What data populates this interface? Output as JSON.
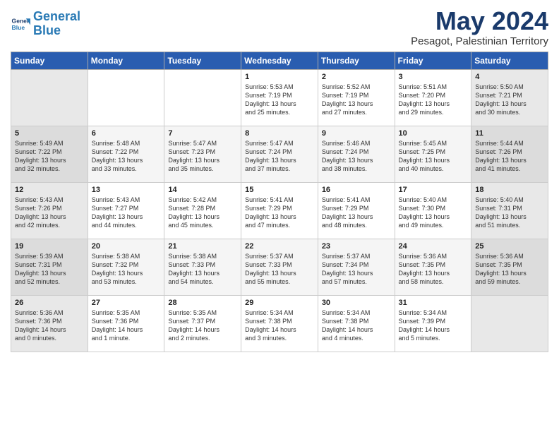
{
  "header": {
    "logo_line1": "General",
    "logo_line2": "Blue",
    "title": "May 2024",
    "subtitle": "Pesagot, Palestinian Territory"
  },
  "weekdays": [
    "Sunday",
    "Monday",
    "Tuesday",
    "Wednesday",
    "Thursday",
    "Friday",
    "Saturday"
  ],
  "weeks": [
    [
      {
        "day": "",
        "info": ""
      },
      {
        "day": "",
        "info": ""
      },
      {
        "day": "",
        "info": ""
      },
      {
        "day": "1",
        "info": "Sunrise: 5:53 AM\nSunset: 7:19 PM\nDaylight: 13 hours\nand 25 minutes."
      },
      {
        "day": "2",
        "info": "Sunrise: 5:52 AM\nSunset: 7:19 PM\nDaylight: 13 hours\nand 27 minutes."
      },
      {
        "day": "3",
        "info": "Sunrise: 5:51 AM\nSunset: 7:20 PM\nDaylight: 13 hours\nand 29 minutes."
      },
      {
        "day": "4",
        "info": "Sunrise: 5:50 AM\nSunset: 7:21 PM\nDaylight: 13 hours\nand 30 minutes."
      }
    ],
    [
      {
        "day": "5",
        "info": "Sunrise: 5:49 AM\nSunset: 7:22 PM\nDaylight: 13 hours\nand 32 minutes."
      },
      {
        "day": "6",
        "info": "Sunrise: 5:48 AM\nSunset: 7:22 PM\nDaylight: 13 hours\nand 33 minutes."
      },
      {
        "day": "7",
        "info": "Sunrise: 5:47 AM\nSunset: 7:23 PM\nDaylight: 13 hours\nand 35 minutes."
      },
      {
        "day": "8",
        "info": "Sunrise: 5:47 AM\nSunset: 7:24 PM\nDaylight: 13 hours\nand 37 minutes."
      },
      {
        "day": "9",
        "info": "Sunrise: 5:46 AM\nSunset: 7:24 PM\nDaylight: 13 hours\nand 38 minutes."
      },
      {
        "day": "10",
        "info": "Sunrise: 5:45 AM\nSunset: 7:25 PM\nDaylight: 13 hours\nand 40 minutes."
      },
      {
        "day": "11",
        "info": "Sunrise: 5:44 AM\nSunset: 7:26 PM\nDaylight: 13 hours\nand 41 minutes."
      }
    ],
    [
      {
        "day": "12",
        "info": "Sunrise: 5:43 AM\nSunset: 7:26 PM\nDaylight: 13 hours\nand 42 minutes."
      },
      {
        "day": "13",
        "info": "Sunrise: 5:43 AM\nSunset: 7:27 PM\nDaylight: 13 hours\nand 44 minutes."
      },
      {
        "day": "14",
        "info": "Sunrise: 5:42 AM\nSunset: 7:28 PM\nDaylight: 13 hours\nand 45 minutes."
      },
      {
        "day": "15",
        "info": "Sunrise: 5:41 AM\nSunset: 7:29 PM\nDaylight: 13 hours\nand 47 minutes."
      },
      {
        "day": "16",
        "info": "Sunrise: 5:41 AM\nSunset: 7:29 PM\nDaylight: 13 hours\nand 48 minutes."
      },
      {
        "day": "17",
        "info": "Sunrise: 5:40 AM\nSunset: 7:30 PM\nDaylight: 13 hours\nand 49 minutes."
      },
      {
        "day": "18",
        "info": "Sunrise: 5:40 AM\nSunset: 7:31 PM\nDaylight: 13 hours\nand 51 minutes."
      }
    ],
    [
      {
        "day": "19",
        "info": "Sunrise: 5:39 AM\nSunset: 7:31 PM\nDaylight: 13 hours\nand 52 minutes."
      },
      {
        "day": "20",
        "info": "Sunrise: 5:38 AM\nSunset: 7:32 PM\nDaylight: 13 hours\nand 53 minutes."
      },
      {
        "day": "21",
        "info": "Sunrise: 5:38 AM\nSunset: 7:33 PM\nDaylight: 13 hours\nand 54 minutes."
      },
      {
        "day": "22",
        "info": "Sunrise: 5:37 AM\nSunset: 7:33 PM\nDaylight: 13 hours\nand 55 minutes."
      },
      {
        "day": "23",
        "info": "Sunrise: 5:37 AM\nSunset: 7:34 PM\nDaylight: 13 hours\nand 57 minutes."
      },
      {
        "day": "24",
        "info": "Sunrise: 5:36 AM\nSunset: 7:35 PM\nDaylight: 13 hours\nand 58 minutes."
      },
      {
        "day": "25",
        "info": "Sunrise: 5:36 AM\nSunset: 7:35 PM\nDaylight: 13 hours\nand 59 minutes."
      }
    ],
    [
      {
        "day": "26",
        "info": "Sunrise: 5:36 AM\nSunset: 7:36 PM\nDaylight: 14 hours\nand 0 minutes."
      },
      {
        "day": "27",
        "info": "Sunrise: 5:35 AM\nSunset: 7:36 PM\nDaylight: 14 hours\nand 1 minute."
      },
      {
        "day": "28",
        "info": "Sunrise: 5:35 AM\nSunset: 7:37 PM\nDaylight: 14 hours\nand 2 minutes."
      },
      {
        "day": "29",
        "info": "Sunrise: 5:34 AM\nSunset: 7:38 PM\nDaylight: 14 hours\nand 3 minutes."
      },
      {
        "day": "30",
        "info": "Sunrise: 5:34 AM\nSunset: 7:38 PM\nDaylight: 14 hours\nand 4 minutes."
      },
      {
        "day": "31",
        "info": "Sunrise: 5:34 AM\nSunset: 7:39 PM\nDaylight: 14 hours\nand 5 minutes."
      },
      {
        "day": "",
        "info": ""
      }
    ]
  ]
}
